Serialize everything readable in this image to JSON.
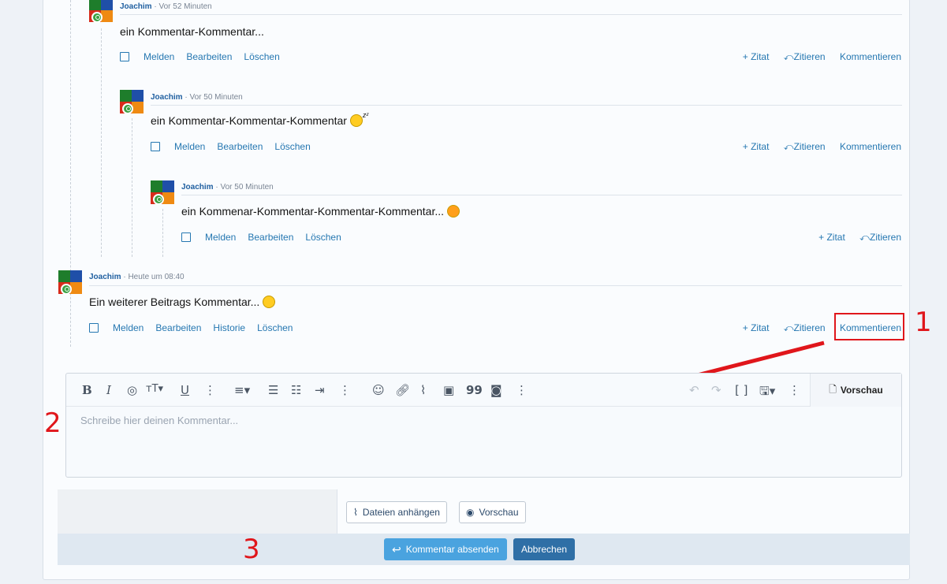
{
  "comments": [
    {
      "user": "Joachim",
      "time": " · Vor 52 Minuten",
      "text": "ein Kommentar-Kommentar...",
      "emoji": ""
    },
    {
      "user": "Joachim",
      "time": " · Vor 50 Minuten",
      "text": "ein Kommentar-Kommentar-Kommentar ",
      "emoji": "sleeping-emoji"
    },
    {
      "user": "Joachim",
      "time": " · Vor 50 Minuten",
      "text": "ein Kommenar-Kommentar-Kommentar-Kommentar... ",
      "emoji": "astonished-emoji"
    },
    {
      "user": "Joachim",
      "time": " · Heute um 08:40",
      "text": "Ein weiterer Beitrags Kommentar... ",
      "emoji": "winking-emoji"
    }
  ],
  "actions": {
    "melden": "Melden",
    "bearbeiten": "Bearbeiten",
    "historie": "Historie",
    "loeschen": "Löschen",
    "zitat": "+ Zitat",
    "zitieren": "Zitieren",
    "kommentieren": "Kommentieren"
  },
  "editor": {
    "placeholder": "Schreibe hier deinen Kommentar...",
    "preview_tab": "Vorschau"
  },
  "buttons": {
    "attach": "Dateien anhängen",
    "preview": "Vorschau",
    "submit": "Kommentar absenden",
    "cancel": "Abbrechen"
  },
  "annotations": {
    "label_1": "1",
    "label_2": "2",
    "label_3": "3",
    "color": "#e0161b"
  },
  "colors": {
    "link": "#2577b1",
    "submit": "#4aa3df",
    "cancel": "#2f6fa6"
  }
}
